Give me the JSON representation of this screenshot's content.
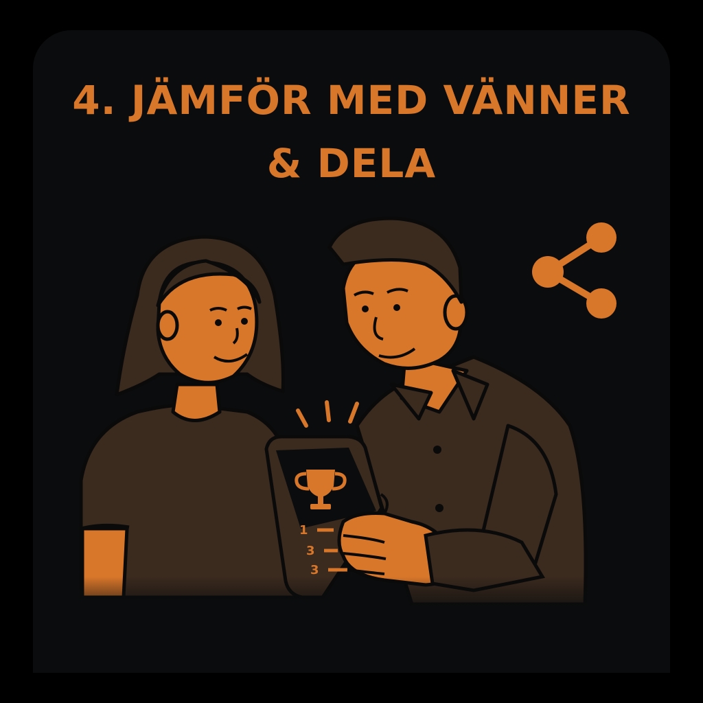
{
  "title": {
    "line1": "4. JÄMFÖR MED VÄNNER",
    "line2": "& DELA"
  },
  "phone": {
    "rank_numbers": [
      "1",
      "3",
      "3"
    ]
  },
  "icons": {
    "share": "share-icon",
    "trophy": "trophy-icon"
  },
  "colors": {
    "background": "#000000",
    "card": "#0b0c0d",
    "accent": "#d8772a",
    "clothing": "#3b2a1e",
    "outline": "#0a0a0a"
  }
}
